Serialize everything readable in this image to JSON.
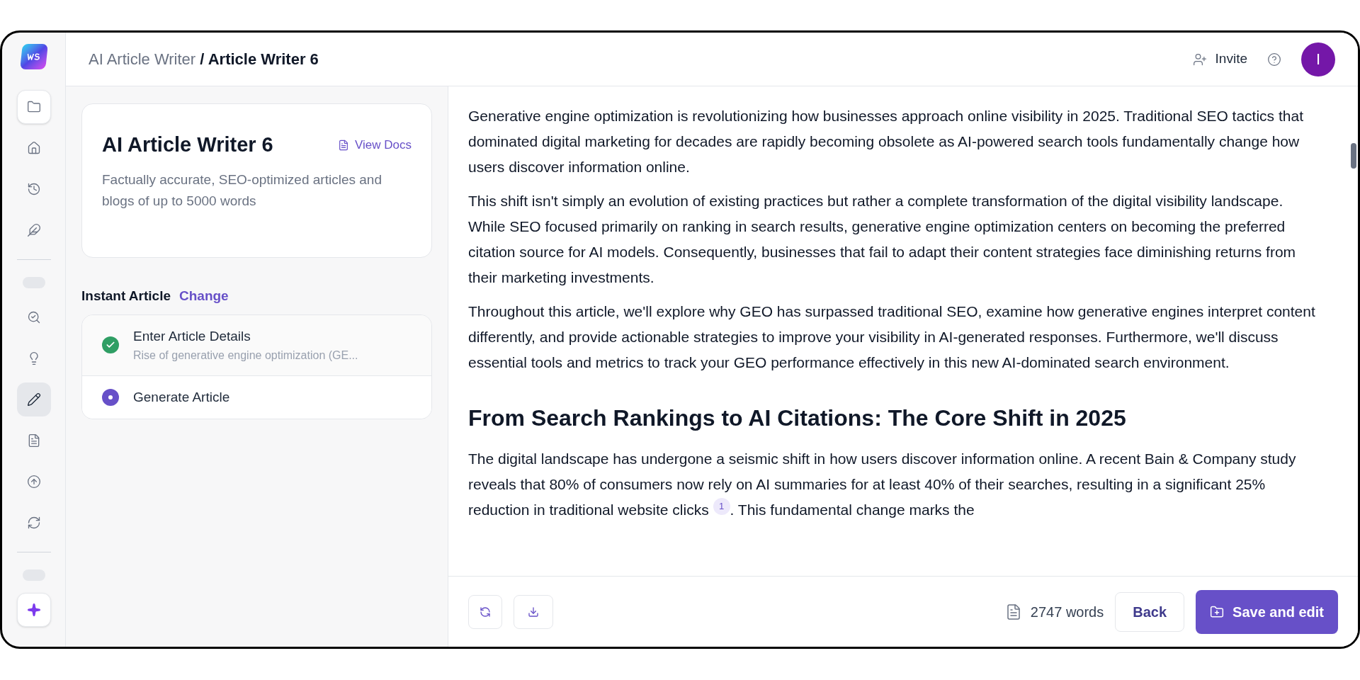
{
  "breadcrumb": {
    "parent": "AI Article Writer",
    "current": "/ Article Writer 6"
  },
  "header_actions": {
    "invite": "Invite",
    "avatar": "I"
  },
  "sidebar": {
    "items": [
      {
        "kind": "button",
        "selected": false
      },
      {
        "kind": "button",
        "selected": false
      },
      {
        "kind": "button",
        "selected": false
      },
      {
        "kind": "button",
        "selected": false
      },
      {
        "kind": "divider"
      },
      {
        "kind": "pill"
      },
      {
        "kind": "button",
        "selected": false
      },
      {
        "kind": "button",
        "selected": false
      },
      {
        "kind": "button",
        "selected": true
      },
      {
        "kind": "button",
        "selected": false
      },
      {
        "kind": "button",
        "selected": false
      },
      {
        "kind": "button",
        "selected": false
      },
      {
        "kind": "divider"
      },
      {
        "kind": "pill"
      },
      {
        "kind": "button",
        "selected": false
      }
    ]
  },
  "tool_card": {
    "title": "AI Article Writer 6",
    "docs_link": "View Docs",
    "description": "Factually accurate, SEO-optimized articles and blogs of up to 5000 words"
  },
  "mode": {
    "label": "Instant Article",
    "change_link": "Change"
  },
  "steps": [
    {
      "title": "Enter Article Details",
      "subtitle": "Rise of generative engine optimization (GE...",
      "completed": true
    },
    {
      "title": "Generate Article",
      "completed": false
    }
  ],
  "article": [
    {
      "kind": "paragraph",
      "text": "Generative engine optimization is revolutionizing how businesses approach online visibility in 2025. Traditional SEO tactics that dominated digital marketing for decades are rapidly becoming obsolete as AI-powered search tools fundamentally change how users discover information online."
    },
    {
      "kind": "paragraph",
      "text": "This shift isn't simply an evolution of existing practices but rather a complete transformation of the digital visibility landscape. While SEO focused primarily on ranking in search results, generative engine optimization centers on becoming the preferred citation source for AI models. Consequently, businesses that fail to adapt their content strategies face diminishing returns from their marketing investments."
    },
    {
      "kind": "paragraph",
      "text": "Throughout this article, we'll explore why GEO has surpassed traditional SEO, examine how generative engines interpret content differently, and provide actionable strategies to improve your visibility in AI-generated responses. Furthermore, we'll discuss essential tools and metrics to track your GEO performance effectively in this new AI-dominated search environment."
    },
    {
      "kind": "heading",
      "text": "From Search Rankings to AI Citations: The Core Shift in 2025"
    },
    {
      "kind": "paragraph",
      "text": "The digital landscape has undergone a seismic shift in how users discover information online. A recent Bain & Company study reveals that 80% of consumers now rely on AI summaries for at least 40% of their searches, resulting in a significant 25% reduction in traditional website clicks",
      "citation": "1",
      "text_after": ". This fundamental change marks the"
    }
  ],
  "footer": {
    "word_count": "2747 words",
    "back": "Back",
    "save": "Save and edit"
  }
}
